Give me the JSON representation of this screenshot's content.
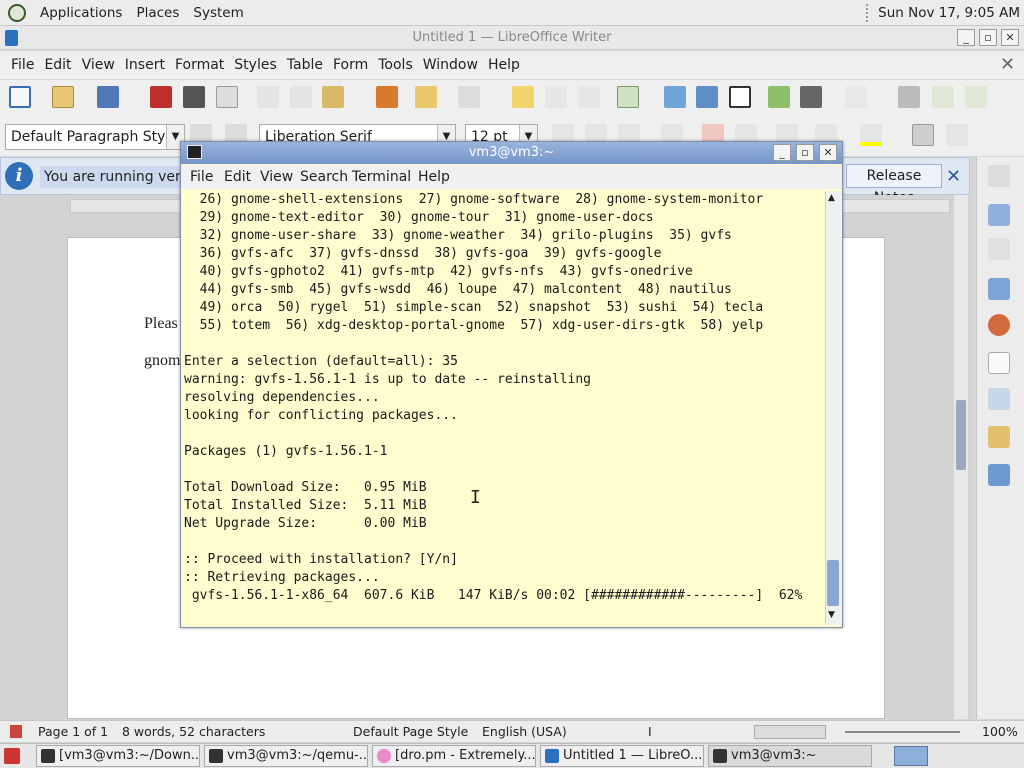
{
  "top_panel": {
    "menus": [
      "Applications",
      "Places",
      "System"
    ],
    "clock": "Sun Nov 17, 9:05 AM"
  },
  "writer": {
    "title": "Untitled 1 — LibreOffice Writer",
    "menu": [
      "File",
      "Edit",
      "View",
      "Insert",
      "Format",
      "Styles",
      "Table",
      "Form",
      "Tools",
      "Window",
      "Help"
    ],
    "paragraph_style": "Default Paragraph Style",
    "font_name": "Liberation Serif",
    "font_size": "12 pt",
    "infobar_text": "You are running version",
    "release_notes": "Release Notes",
    "doc_line1": "Pleas",
    "doc_line2": "gnom",
    "status": {
      "page": "Page 1 of 1",
      "words": "8 words, 52 characters",
      "page_style": "Default Page Style",
      "language": "English (USA)",
      "zoom": "100%"
    }
  },
  "terminal": {
    "title": "vm3@vm3:~",
    "menu": [
      "File",
      "Edit",
      "View",
      "Search",
      "Terminal",
      "Help"
    ],
    "lines": [
      "  26) gnome-shell-extensions  27) gnome-software  28) gnome-system-monitor",
      "  29) gnome-text-editor  30) gnome-tour  31) gnome-user-docs",
      "  32) gnome-user-share  33) gnome-weather  34) grilo-plugins  35) gvfs",
      "  36) gvfs-afc  37) gvfs-dnssd  38) gvfs-goa  39) gvfs-google",
      "  40) gvfs-gphoto2  41) gvfs-mtp  42) gvfs-nfs  43) gvfs-onedrive",
      "  44) gvfs-smb  45) gvfs-wsdd  46) loupe  47) malcontent  48) nautilus",
      "  49) orca  50) rygel  51) simple-scan  52) snapshot  53) sushi  54) tecla",
      "  55) totem  56) xdg-desktop-portal-gnome  57) xdg-user-dirs-gtk  58) yelp",
      "",
      "Enter a selection (default=all): 35",
      "warning: gvfs-1.56.1-1 is up to date -- reinstalling",
      "resolving dependencies...",
      "looking for conflicting packages...",
      "",
      "Packages (1) gvfs-1.56.1-1",
      "",
      "Total Download Size:   0.95 MiB",
      "Total Installed Size:  5.11 MiB",
      "Net Upgrade Size:      0.00 MiB",
      "",
      ":: Proceed with installation? [Y/n]",
      ":: Retrieving packages...",
      " gvfs-1.56.1-1-x86_64  607.6 KiB   147 KiB/s 00:02 [############---------]  62%"
    ]
  },
  "taskbar": {
    "tasks": [
      "[vm3@vm3:~/Down...",
      "vm3@vm3:~/qemu-...",
      "[dro.pm - Extremely...",
      "Untitled 1 — LibreO...",
      "vm3@vm3:~"
    ]
  },
  "colors": {
    "terminal_bg": "#fffdd0",
    "terminal_title": "#7595c9",
    "info_icon": "#2f6fb8"
  }
}
